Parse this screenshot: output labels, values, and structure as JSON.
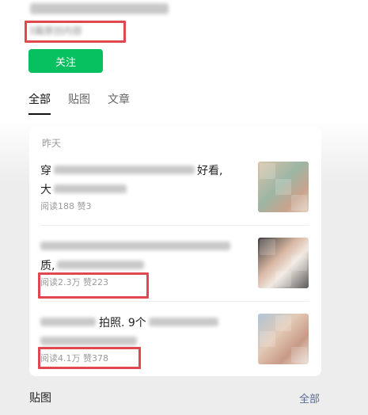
{
  "header": {
    "original_count": "3篇原创内容",
    "follow_label": "关注"
  },
  "tabs": [
    {
      "label": "全部",
      "active": true
    },
    {
      "label": "贴图",
      "active": false
    },
    {
      "label": "文章",
      "active": false
    }
  ],
  "feed": {
    "date_label": "昨天",
    "articles": [
      {
        "title_start": "穿",
        "title_end": "好看,",
        "title_line2": "大",
        "stats": "阅读188  赞3",
        "thumb_icon": "collage-image-icon"
      },
      {
        "title_start": "",
        "title_end": "",
        "title_line2": "质,",
        "stats": "阅读2.3万  赞223",
        "thumb_icon": "collage-image-icon"
      },
      {
        "title_start": "",
        "title_end": "拍照. 9个",
        "title_line2": "",
        "stats": "阅读4.1万  赞378",
        "thumb_icon": "collage-image-icon"
      }
    ]
  },
  "footer": {
    "section_label": "贴图",
    "all_link": "全部"
  },
  "colors": {
    "accent_green": "#07c160",
    "annotation_red": "#e0474f",
    "link_blue": "#576b95"
  }
}
